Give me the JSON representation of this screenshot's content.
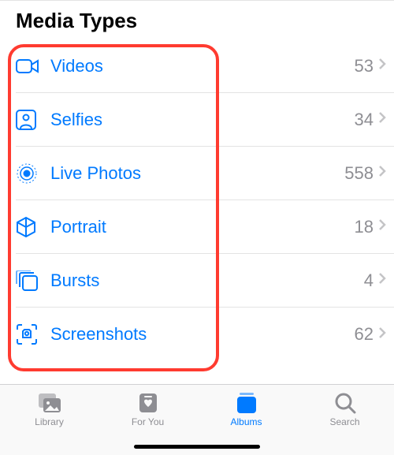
{
  "section": {
    "title": "Media Types"
  },
  "mediaTypes": [
    {
      "icon": "video-icon",
      "label": "Videos",
      "count": "53"
    },
    {
      "icon": "selfies-icon",
      "label": "Selfies",
      "count": "34"
    },
    {
      "icon": "live-photos-icon",
      "label": "Live Photos",
      "count": "558"
    },
    {
      "icon": "portrait-icon",
      "label": "Portrait",
      "count": "18"
    },
    {
      "icon": "bursts-icon",
      "label": "Bursts",
      "count": "4"
    },
    {
      "icon": "screenshots-icon",
      "label": "Screenshots",
      "count": "62"
    }
  ],
  "tabs": [
    {
      "icon": "library-tab-icon",
      "label": "Library",
      "selected": false
    },
    {
      "icon": "foryou-tab-icon",
      "label": "For You",
      "selected": false
    },
    {
      "icon": "albums-tab-icon",
      "label": "Albums",
      "selected": true
    },
    {
      "icon": "search-tab-icon",
      "label": "Search",
      "selected": false
    }
  ],
  "colors": {
    "accent": "#007aff",
    "secondary": "#8e8e93",
    "highlight": "#ff3b30"
  }
}
